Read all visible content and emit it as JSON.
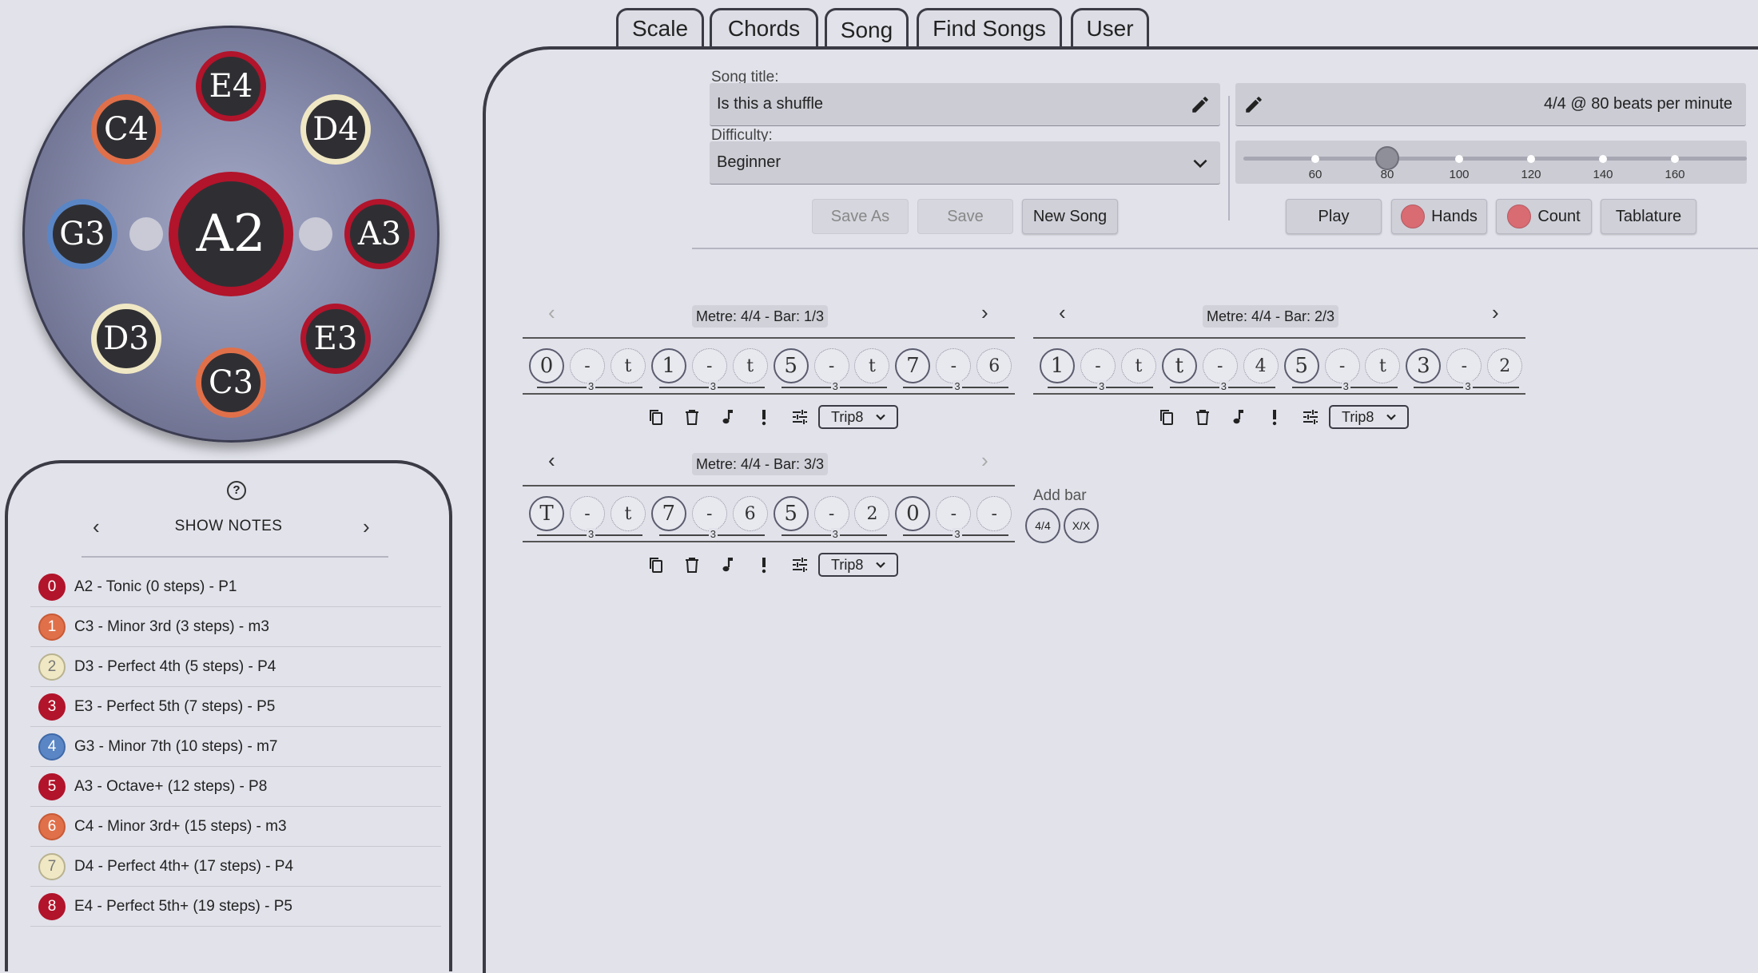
{
  "tabs": [
    "Scale",
    "Chords",
    "Song",
    "Find Songs",
    "User"
  ],
  "active_tab": "Song",
  "drum": {
    "center": "A2",
    "notes": [
      "E4",
      "D4",
      "A3",
      "E3",
      "C3",
      "D3",
      "G3",
      "C4"
    ]
  },
  "notes_panel": {
    "toggle_label": "SHOW NOTES",
    "items": [
      {
        "num": "0",
        "text": "A2 - Tonic (0 steps) - P1"
      },
      {
        "num": "1",
        "text": "C3 - Minor 3rd (3 steps) - m3"
      },
      {
        "num": "2",
        "text": "D3 - Perfect 4th (5 steps) - P4"
      },
      {
        "num": "3",
        "text": "E3 - Perfect 5th (7 steps) - P5"
      },
      {
        "num": "4",
        "text": "G3 - Minor 7th (10 steps) - m7"
      },
      {
        "num": "5",
        "text": "A3 - Octave+ (12 steps) - P8"
      },
      {
        "num": "6",
        "text": "C4 - Minor 3rd+ (15 steps) - m3"
      },
      {
        "num": "7",
        "text": "D4 - Perfect 4th+ (17 steps) - P4"
      },
      {
        "num": "8",
        "text": "E4 - Perfect 5th+ (19 steps) - P5"
      }
    ]
  },
  "song": {
    "title_label": "Song title:",
    "title_value": "Is this a shuffle",
    "difficulty_label": "Difficulty:",
    "difficulty_value": "Beginner",
    "tempo_text": "4/4 @ 80 beats per minute",
    "tempo_value": 80,
    "tempo_marks": [
      "60",
      "80",
      "100",
      "120",
      "140",
      "160"
    ],
    "buttons": {
      "save_as": "Save As",
      "save": "Save",
      "new_song": "New Song",
      "play": "Play",
      "hands": "Hands",
      "count": "Count",
      "tablature": "Tablature"
    }
  },
  "bars": [
    {
      "header": "Metre: 4/4 - Bar: 1/3",
      "beats": [
        "0",
        "-",
        "t",
        "1",
        "-",
        "t",
        "5",
        "-",
        "t",
        "7",
        "-",
        "6"
      ],
      "triplet": "3",
      "select": "Trip8"
    },
    {
      "header": "Metre: 4/4 - Bar: 2/3",
      "beats": [
        "1",
        "-",
        "t",
        "t",
        "-",
        "4",
        "5",
        "-",
        "t",
        "3",
        "-",
        "2"
      ],
      "triplet": "3",
      "select": "Trip8"
    },
    {
      "header": "Metre: 4/4 - Bar: 3/3",
      "beats": [
        "T",
        "-",
        "t",
        "7",
        "-",
        "6",
        "5",
        "-",
        "2",
        "0",
        "-",
        "-"
      ],
      "triplet": "3",
      "select": "Trip8"
    }
  ],
  "add_bar": {
    "label": "Add bar",
    "options": [
      "4/4",
      "X/X"
    ]
  },
  "colors": {
    "red": "#b1142b",
    "orange": "#e0704a",
    "cream": "#f0e8c4",
    "blue": "#5a86c6",
    "dark": "#2f2f33"
  }
}
